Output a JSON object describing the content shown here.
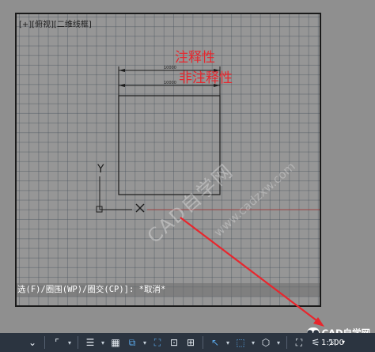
{
  "viewport": {
    "label": "[+][俯视][二维线框]"
  },
  "annotations": {
    "annotative": "注释性",
    "non_annotative": "非注释性",
    "accent_color": "#e8262d"
  },
  "dimensions": {
    "top_value": "10000",
    "bottom_value": "10000"
  },
  "ucs": {
    "y_label": "Y"
  },
  "command_line": {
    "text": "选(F)/圈围(WP)/圈交(CP)]: *取消*"
  },
  "watermark": {
    "text": "CAD自学网",
    "url": "www.cadzxw.com"
  },
  "statusbar": {
    "wechat_label": "CAD自学网",
    "scale": "1:100",
    "icons": [
      "snap-icon",
      "grid-icon",
      "ortho-icon",
      "polar-icon",
      "isodraft-icon",
      "osnap-icon",
      "otrack-icon",
      "lineweight-icon",
      "transparency-icon",
      "selection-cycling-icon",
      "3d-osnap-icon",
      "dynamic-ucs-icon",
      "gizmo-icon",
      "annotation-visibility-icon",
      "autoscale-icon",
      "annotation-scale-icon",
      "workspace-icon",
      "lock-icon"
    ]
  }
}
